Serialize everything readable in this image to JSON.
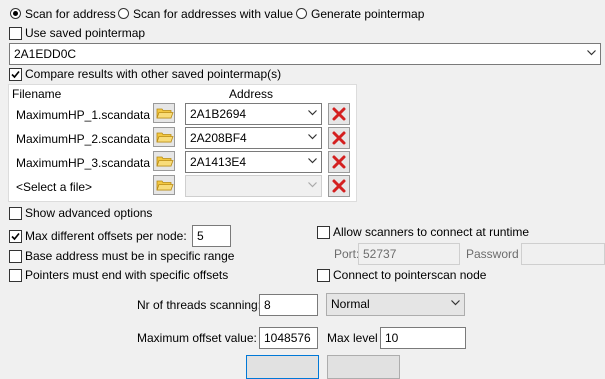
{
  "scan_mode": {
    "options": [
      {
        "label": "Scan for address",
        "selected": true
      },
      {
        "label": "Scan for addresses with value",
        "selected": false
      },
      {
        "label": "Generate pointermap",
        "selected": false
      }
    ]
  },
  "use_saved_pointermap": {
    "label": "Use saved pointermap",
    "checked": false
  },
  "address_combo": {
    "value": "2A1EDD0C"
  },
  "compare": {
    "label": "Compare results with other saved pointermap(s)",
    "checked": true,
    "headers": {
      "filename": "Filename",
      "address": "Address"
    },
    "rows": [
      {
        "filename": "MaximumHP_1.scandata",
        "address": "2A1B2694"
      },
      {
        "filename": "MaximumHP_2.scandata",
        "address": "2A208BF4"
      },
      {
        "filename": "MaximumHP_3.scandata",
        "address": "2A1413E4"
      },
      {
        "filename": "<Select a file>",
        "address": ""
      }
    ]
  },
  "options": {
    "show_advanced": {
      "label": "Show advanced options",
      "checked": false
    },
    "max_offsets": {
      "label": "Max different offsets per node:",
      "checked": true,
      "value": "5"
    },
    "base_range": {
      "label": "Base address must be in specific range",
      "checked": false
    },
    "specific_offsets": {
      "label": "Pointers must end with specific offsets",
      "checked": false
    }
  },
  "network": {
    "allow_scanners": {
      "label": "Allow scanners to connect at runtime",
      "checked": false
    },
    "port_label": "Port:",
    "port_value": "52737",
    "password_label": "Password",
    "password_value": "",
    "connect_node": {
      "label": "Connect to pointerscan node",
      "checked": false
    }
  },
  "threads": {
    "label": "Nr of threads scanning:",
    "value": "8",
    "priority": "Normal"
  },
  "offset": {
    "label": "Maximum offset value:",
    "value": "1048576",
    "max_level_label": "Max level",
    "max_level_value": "10"
  },
  "colors": {
    "delete_red": "#d42020",
    "folder_yellow": "#f3c842",
    "accent": "#0078d7"
  }
}
